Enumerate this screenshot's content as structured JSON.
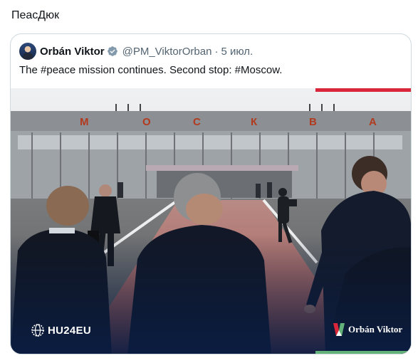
{
  "post": {
    "text": "ПеасДюк"
  },
  "quote": {
    "author_name": "Orbán Viktor",
    "handle": "@PM_ViktorOrban",
    "separator": "·",
    "date": "5 июл.",
    "text": "The #peace mission continues. Second stop: #Moscow.",
    "verified_color": "#829aab"
  },
  "media": {
    "sign_letters": [
      "М",
      "О",
      "С",
      "К",
      "В",
      "А"
    ],
    "brand_left": "HU24EU",
    "brand_right": "Orbán Viktor",
    "accent_red": "#d9263a",
    "accent_green": "#63b27a"
  }
}
